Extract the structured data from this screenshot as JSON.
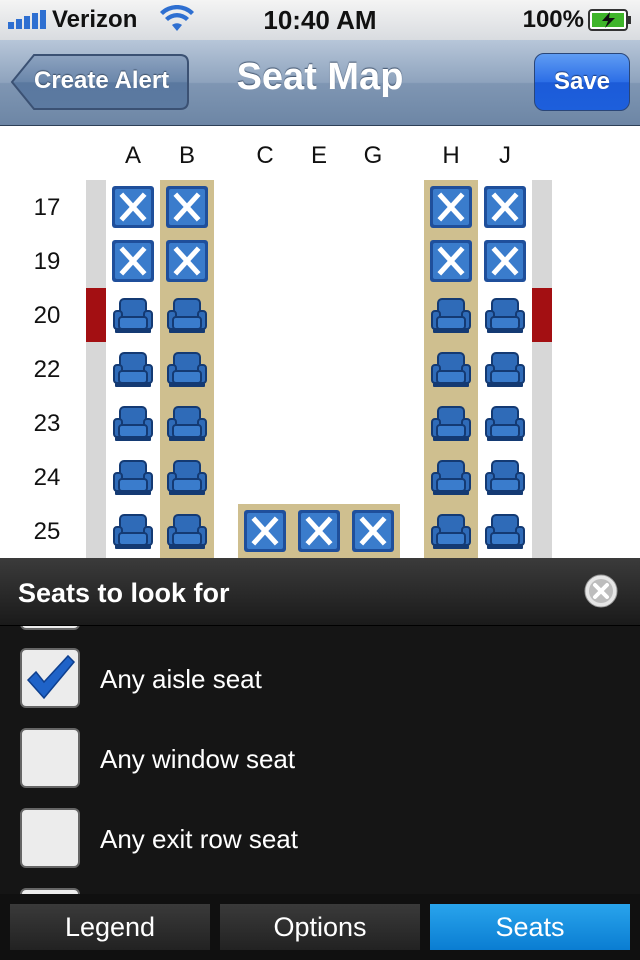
{
  "status_bar": {
    "carrier": "Verizon",
    "time": "10:40 AM",
    "battery": "100%"
  },
  "nav": {
    "title": "Seat Map",
    "back_label": "Create Alert",
    "save_label": "Save"
  },
  "seat_map": {
    "columns": [
      "A",
      "B",
      "C",
      "E",
      "G",
      "H",
      "J"
    ],
    "rows": [
      {
        "number": "17",
        "seats": {
          "A": "occupied",
          "B": "occupied",
          "H": "occupied",
          "J": "occupied"
        }
      },
      {
        "number": "19",
        "seats": {
          "A": "occupied",
          "B": "occupied",
          "H": "occupied",
          "J": "occupied"
        }
      },
      {
        "number": "20",
        "exit_row": true,
        "seats": {
          "A": "available",
          "B": "available",
          "H": "available",
          "J": "available"
        }
      },
      {
        "number": "22",
        "seats": {
          "A": "available",
          "B": "available",
          "H": "available",
          "J": "available"
        }
      },
      {
        "number": "23",
        "seats": {
          "A": "available",
          "B": "available",
          "H": "available",
          "J": "available"
        }
      },
      {
        "number": "24",
        "seats": {
          "A": "available",
          "B": "available",
          "H": "available",
          "J": "available"
        }
      },
      {
        "number": "25",
        "seats": {
          "A": "available",
          "B": "available",
          "C": "occupied",
          "E": "occupied",
          "G": "occupied",
          "H": "available",
          "J": "available"
        }
      }
    ],
    "colors": {
      "seat_blue": "#2f6bb8",
      "aisle_tan": "#cfbf8f",
      "exit_red": "#a30f12",
      "wall_gray": "#d7d7d7"
    }
  },
  "panel": {
    "title": "Seats to look for",
    "options": [
      {
        "label": "Any aisle seat",
        "checked": true
      },
      {
        "label": "Any window seat",
        "checked": false
      },
      {
        "label": "Any exit row seat",
        "checked": false
      }
    ]
  },
  "tabs": [
    {
      "label": "Legend",
      "active": false
    },
    {
      "label": "Options",
      "active": false
    },
    {
      "label": "Seats",
      "active": true
    }
  ],
  "icons": {
    "signal": "signal-bars-icon",
    "wifi": "wifi-icon",
    "battery": "battery-charging-icon",
    "close": "close-circle-icon",
    "check": "checkmark-icon",
    "seat_available": "seat-icon",
    "seat_occupied": "x-seat-icon"
  }
}
